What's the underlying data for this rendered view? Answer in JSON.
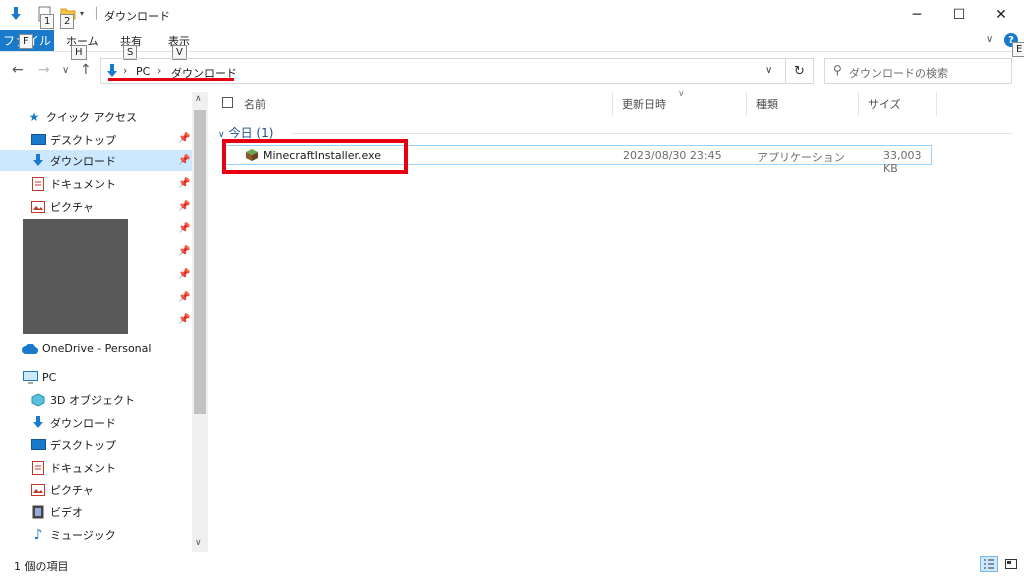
{
  "titlebar": {
    "title": "ダウンロード",
    "keytips": [
      "1",
      "2"
    ],
    "separator": "│",
    "minimize_glyph": "─",
    "maximize_glyph": "☐",
    "close_glyph": "✕"
  },
  "ribbon": {
    "file_label": "ファイル",
    "file_keytip": "F",
    "tabs": [
      {
        "label": "ホーム",
        "keytip": "H"
      },
      {
        "label": "共有",
        "keytip": "S"
      },
      {
        "label": "表示",
        "keytip": "V"
      }
    ],
    "help_keytip": "E"
  },
  "address": {
    "crumbs": [
      "PC",
      "ダウンロード"
    ],
    "chevron": "›"
  },
  "search": {
    "placeholder": "ダウンロードの検索"
  },
  "sidebar": {
    "quick_access": "クイック アクセス",
    "pinned": [
      {
        "label": "デスクトップ",
        "icon": "desktop-icon"
      },
      {
        "label": "ダウンロード",
        "icon": "download-icon",
        "selected": true
      },
      {
        "label": "ドキュメント",
        "icon": "documents-icon"
      },
      {
        "label": "ピクチャ",
        "icon": "pictures-icon"
      }
    ],
    "onedrive": "OneDrive - Personal",
    "pc": "PC",
    "pc_items": [
      {
        "label": "3D オブジェクト",
        "icon": "3d-objects-icon"
      },
      {
        "label": "ダウンロード",
        "icon": "download-icon"
      },
      {
        "label": "デスクトップ",
        "icon": "desktop-icon"
      },
      {
        "label": "ドキュメント",
        "icon": "documents-icon"
      },
      {
        "label": "ピクチャ",
        "icon": "pictures-icon"
      },
      {
        "label": "ビデオ",
        "icon": "videos-icon"
      },
      {
        "label": "ミュージック",
        "icon": "music-icon"
      }
    ]
  },
  "columns": {
    "name": "名前",
    "date": "更新日時",
    "type": "種類",
    "size": "サイズ"
  },
  "group": {
    "label": "今日 (1)"
  },
  "file": {
    "name": "MinecraftInstaller.exe",
    "date": "2023/08/30 23:45",
    "type": "アプリケーション",
    "size": "33,003 KB"
  },
  "status": {
    "item_count": "1 個の項目"
  },
  "colors": {
    "accent": "#1979ca",
    "selection": "#cce8ff",
    "annotation_red": "#e60012"
  }
}
